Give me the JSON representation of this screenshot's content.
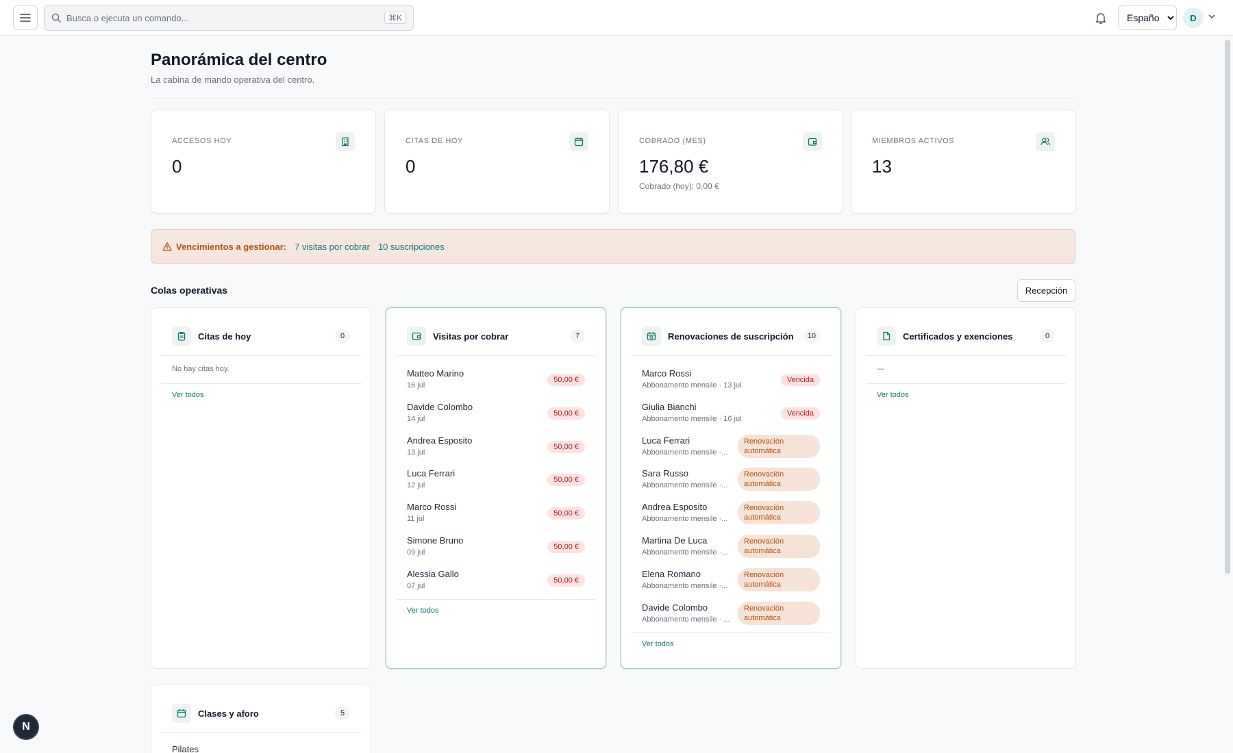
{
  "topbar": {
    "search_placeholder": "Busca o ejecuta un comando...",
    "shortcut": "⌘K",
    "language": "Español",
    "language_options": [
      "Español"
    ],
    "avatar_initial": "D"
  },
  "page": {
    "title": "Panorámica del centro",
    "subtitle": "La cabina de mando operativa del centro."
  },
  "kpis": [
    {
      "label": "ACCESOS HOY",
      "value": "0",
      "sub": "",
      "icon": "building-icon"
    },
    {
      "label": "CITAS DE HOY",
      "value": "0",
      "sub": "",
      "icon": "calendar-icon"
    },
    {
      "label": "COBRADO (MES)",
      "value": "176,80 €",
      "sub": "Cobrado (hoy): 0,00 €",
      "icon": "wallet-icon"
    },
    {
      "label": "MIEMBROS ACTIVOS",
      "value": "13",
      "sub": "",
      "icon": "users-icon"
    }
  ],
  "alert": {
    "label": "Vencimientos a gestionar:",
    "link1": "7 visitas por cobrar",
    "link2": "10 suscripciones"
  },
  "section": {
    "title": "Colas operativas",
    "button": "Recepción"
  },
  "queues": {
    "citas": {
      "title": "Citas de hoy",
      "count": "0",
      "empty": "No hay citas hoy.",
      "link": "Ver todos"
    },
    "visitas": {
      "title": "Visitas por cobrar",
      "count": "7",
      "link": "Ver todos",
      "items": [
        {
          "name": "Matteo Marino",
          "date": "16 jul",
          "amount": "50,00 €"
        },
        {
          "name": "Davide Colombo",
          "date": "14 jul",
          "amount": "50,00 €"
        },
        {
          "name": "Andrea Esposito",
          "date": "13 jul",
          "amount": "50,00 €"
        },
        {
          "name": "Luca Ferrari",
          "date": "12 jul",
          "amount": "50,00 €"
        },
        {
          "name": "Marco Rossi",
          "date": "11 jul",
          "amount": "50,00 €"
        },
        {
          "name": "Simone Bruno",
          "date": "09 jul",
          "amount": "50,00 €"
        },
        {
          "name": "Alessia Gallo",
          "date": "07 jul",
          "amount": "50,00 €"
        }
      ]
    },
    "renovaciones": {
      "title": "Renovaciones de suscripción",
      "count": "10",
      "link": "Ver todos",
      "items": [
        {
          "name": "Marco Rossi",
          "sub": "Abbonamento mensile · 13 jul",
          "status": "Vencida",
          "kind": "red"
        },
        {
          "name": "Giulia Bianchi",
          "sub": "Abbonamento mensile · 16 jul",
          "status": "Vencida",
          "kind": "red"
        },
        {
          "name": "Luca Ferrari",
          "sub": "Abbonamento mensile ·...",
          "status": "Renovación automática",
          "kind": "orange"
        },
        {
          "name": "Sara Russo",
          "sub": "Abbonamento mensile ·...",
          "status": "Renovación automática",
          "kind": "orange"
        },
        {
          "name": "Andrea Esposito",
          "sub": "Abbonamento mensile ·...",
          "status": "Renovación automática",
          "kind": "orange"
        },
        {
          "name": "Martina De Luca",
          "sub": "Abbonamento mensile ·...",
          "status": "Renovación automática",
          "kind": "orange"
        },
        {
          "name": "Elena Romano",
          "sub": "Abbonamento mensile ·...",
          "status": "Renovación automática",
          "kind": "orange"
        },
        {
          "name": "Davide Colombo",
          "sub": "Abbonamento mensile · ...",
          "status": "Renovación automática",
          "kind": "orange"
        }
      ]
    },
    "certificados": {
      "title": "Certificados y exenciones",
      "count": "0",
      "empty": "—",
      "link": "Ver todos"
    },
    "clases": {
      "title": "Clases y aforo",
      "count": "5",
      "first_item": "Pilates"
    }
  },
  "fab_label": "N",
  "colors": {
    "accent": "#0f766e",
    "danger": "#b91c1c",
    "warning": "#b45309"
  }
}
